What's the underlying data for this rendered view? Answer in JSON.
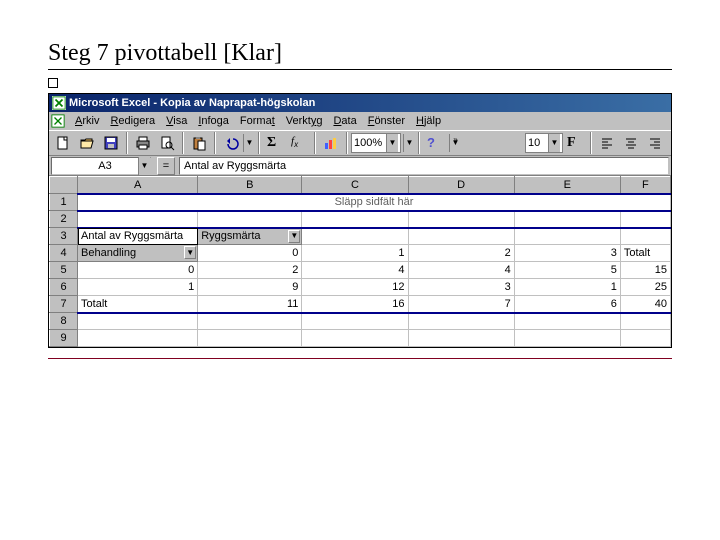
{
  "slide": {
    "title": "Steg 7 pivottabell [Klar]"
  },
  "window": {
    "title": "Microsoft Excel - Kopia av Naprapat-högskolan"
  },
  "menubar": {
    "items": [
      "Arkiv",
      "Redigera",
      "Visa",
      "Infoga",
      "Format",
      "Verktyg",
      "Data",
      "Fönster",
      "Hjälp"
    ]
  },
  "toolbar": {
    "zoom": "100%",
    "font_size": "10",
    "bold": "F"
  },
  "formulabar": {
    "cell_ref": "A3",
    "formula": "Antal av Ryggsmärta"
  },
  "columns": [
    "A",
    "B",
    "C",
    "D",
    "E",
    "F"
  ],
  "row_headers": [
    "1",
    "2",
    "3",
    "4",
    "5",
    "6",
    "7",
    "8",
    "9"
  ],
  "pivot": {
    "page_drop_hint": "Släpp sidfält här",
    "data_field_label": "Antal av Ryggsmärta",
    "col_field_label": "Ryggsmärta",
    "row_field_label": "Behandling",
    "col_headers": [
      "0",
      "1",
      "2",
      "3"
    ],
    "grand_total_col_label": "Totalt",
    "rows": [
      {
        "label": "0",
        "vals": [
          "2",
          "4",
          "4",
          "5"
        ],
        "total": "15"
      },
      {
        "label": "1",
        "vals": [
          "9",
          "12",
          "3",
          "1"
        ],
        "total": "25"
      }
    ],
    "grand_row_label": "Totalt",
    "grand_row_vals": [
      "11",
      "16",
      "7",
      "6"
    ],
    "grand_total": "40"
  }
}
